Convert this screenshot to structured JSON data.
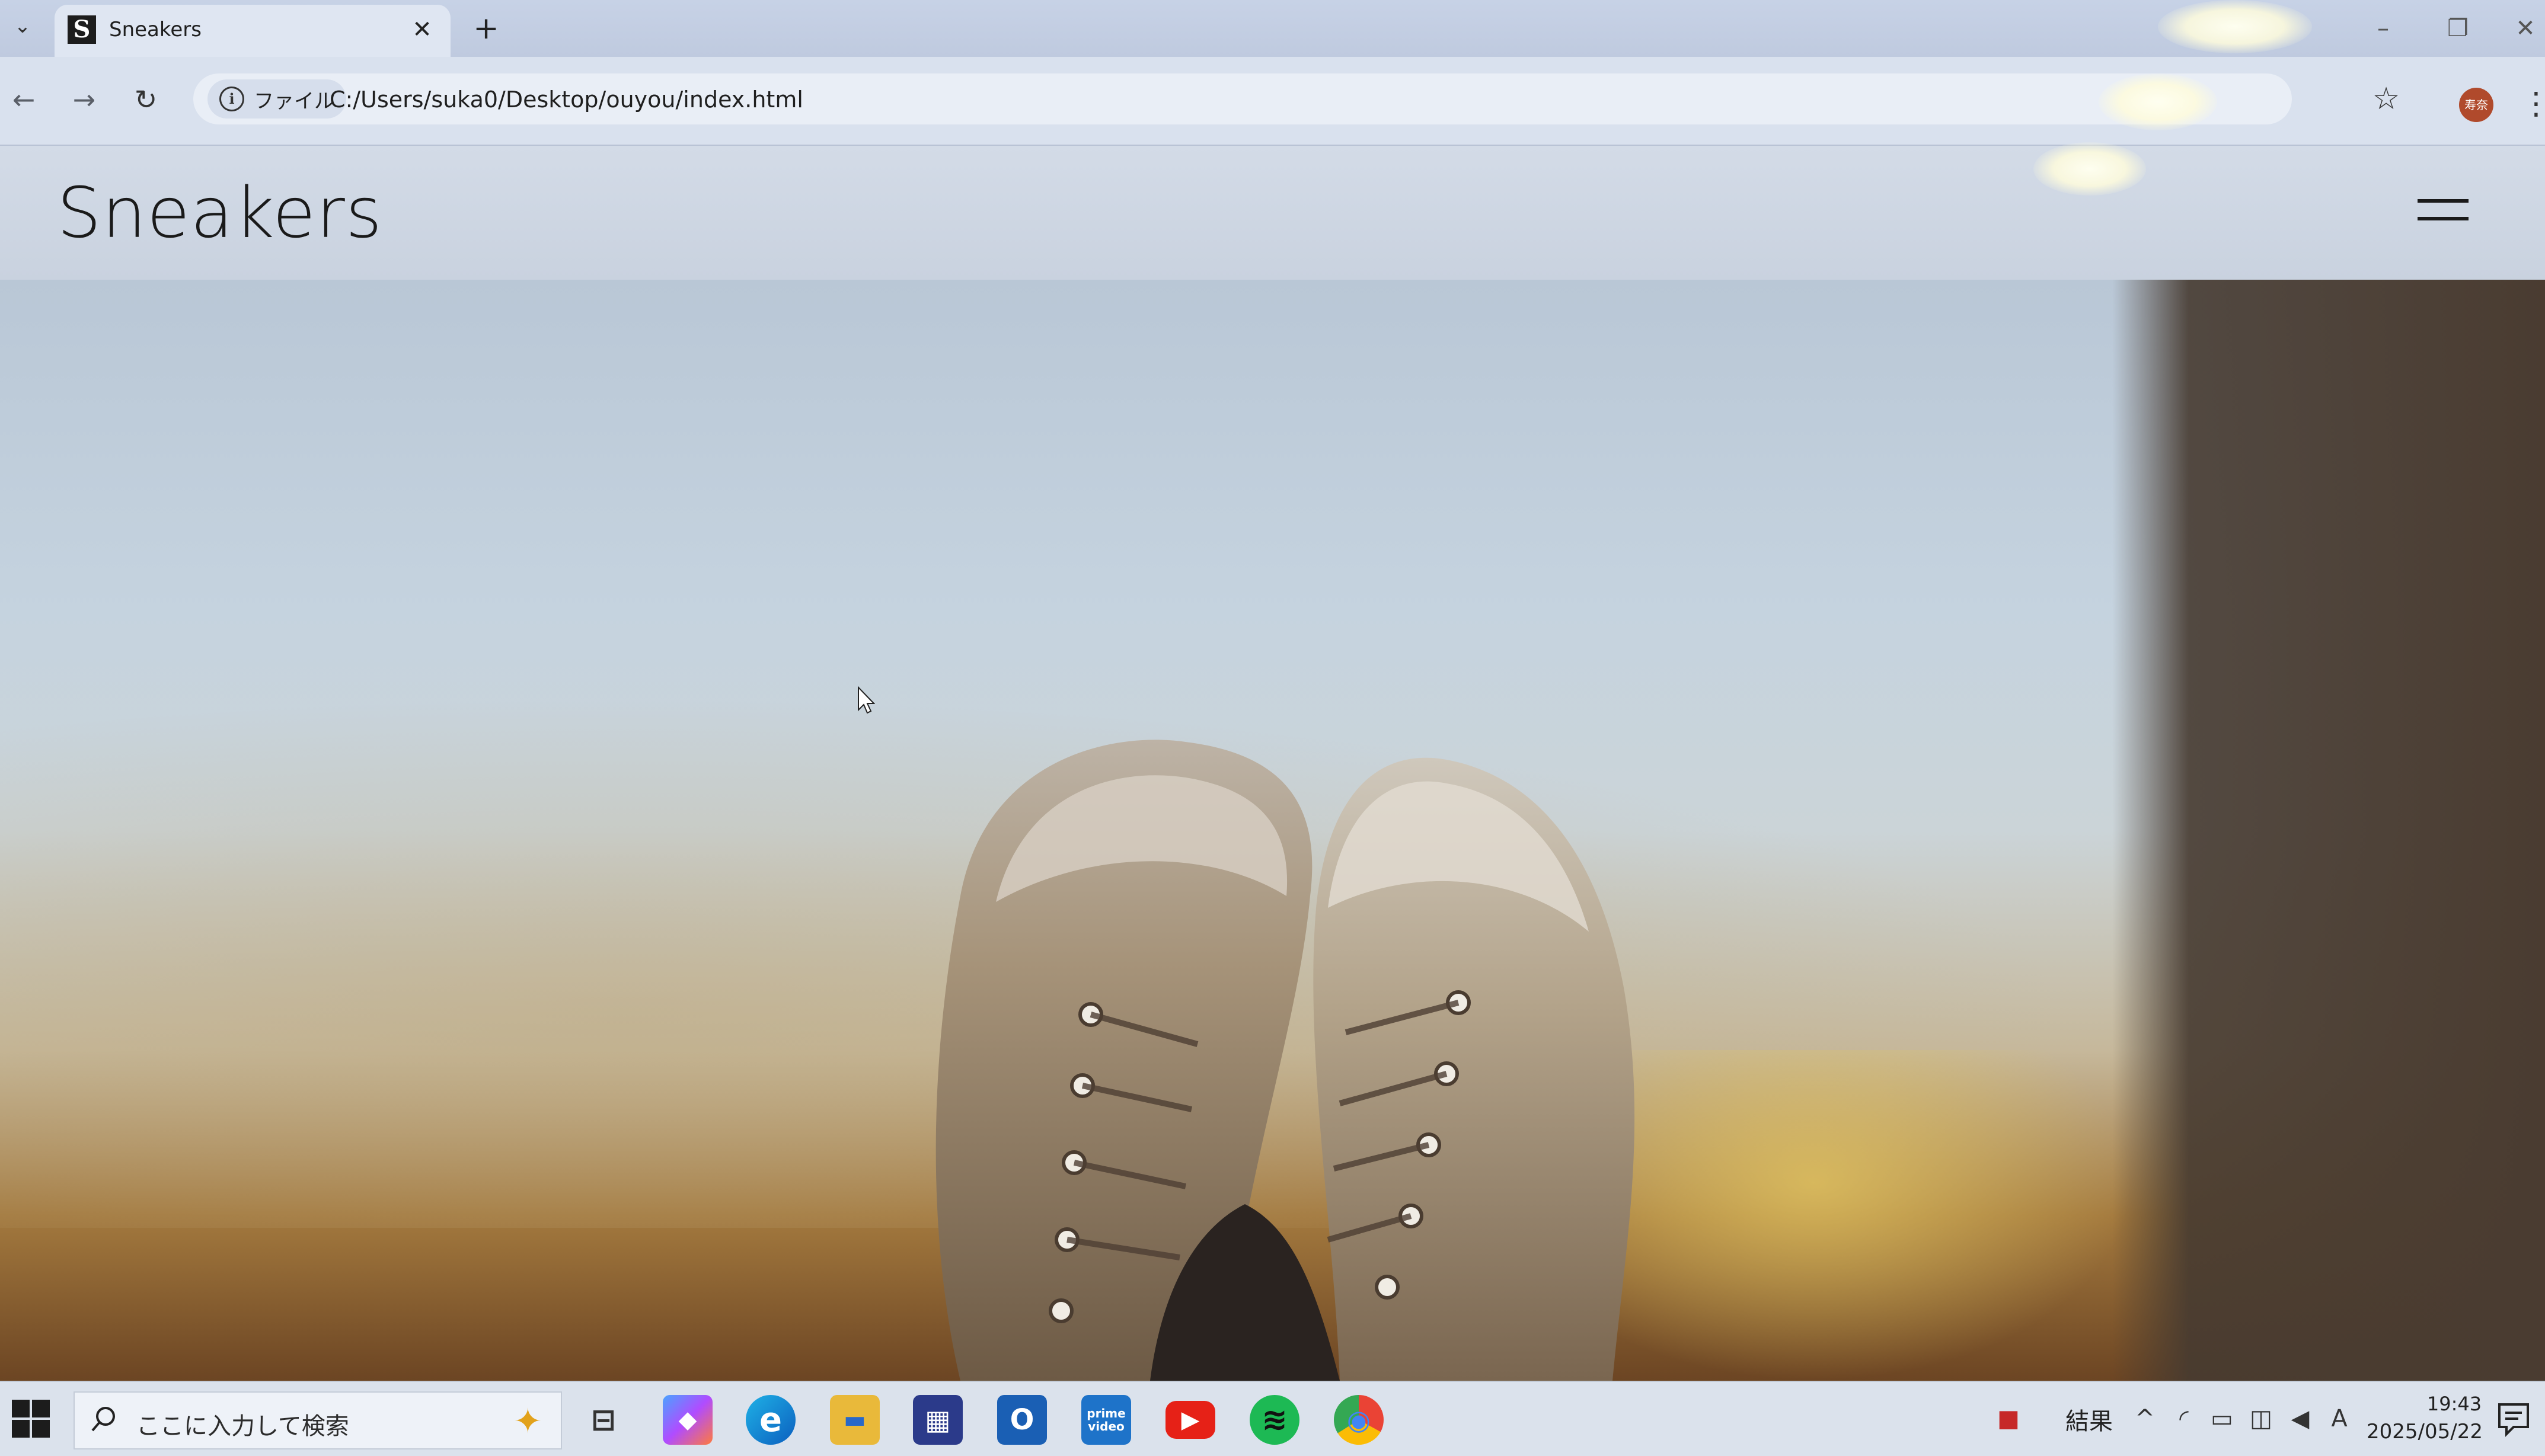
{
  "browser": {
    "tab": {
      "title": "Sneakers",
      "favicon_letter": "S",
      "close_glyph": "✕"
    },
    "new_tab_glyph": "+",
    "window_controls": {
      "minimize": "–",
      "maximize": "❐",
      "close": "✕"
    },
    "nav": {
      "back_glyph": "←",
      "forward_glyph": "→",
      "reload_glyph": "↻"
    },
    "address": {
      "scheme_chip_label": "ファイル",
      "url": "C:/Users/suka0/Desktop/ouyou/index.html"
    },
    "bookmark_glyph": "☆",
    "profile_initials": "寿奈",
    "menu_glyph": "⋮"
  },
  "page": {
    "logo": "Sneakers",
    "hero_image": "sneakers-hero-image"
  },
  "taskbar": {
    "search_placeholder": "ここに入力して検索",
    "apps": [
      {
        "name": "task-view",
        "label": "⊟"
      },
      {
        "name": "copilot",
        "label": "◆"
      },
      {
        "name": "edge",
        "label": "e"
      },
      {
        "name": "file-explorer",
        "label": "▬"
      },
      {
        "name": "microsoft-store",
        "label": "▦"
      },
      {
        "name": "outlook",
        "label": "O"
      },
      {
        "name": "prime-video",
        "label": "prime video"
      },
      {
        "name": "youtube",
        "label": "▶"
      },
      {
        "name": "spotify",
        "label": "≋"
      },
      {
        "name": "chrome",
        "label": "◉"
      }
    ],
    "news": "結果",
    "ime_indicator": "A",
    "clock": {
      "time": "19:43",
      "date": "2025/05/22"
    }
  },
  "colors": {
    "accent_youtube": "#e62117",
    "accent_spotify": "#1db954",
    "accent_outlook": "#1a5fb4",
    "accent_store": "#2b3a8a",
    "accent_prime": "#1e73c9"
  }
}
